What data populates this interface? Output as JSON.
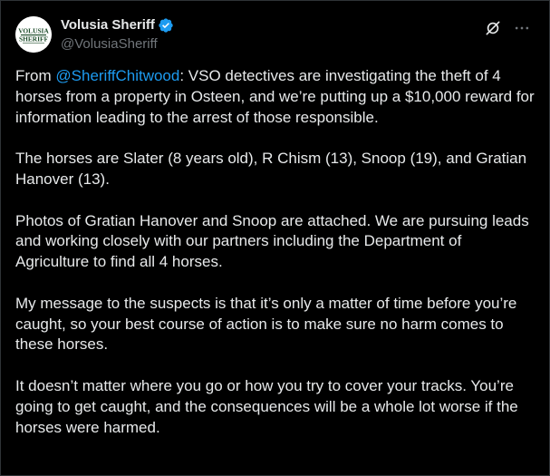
{
  "post": {
    "author": {
      "display_name": "Volusia Sheriff",
      "handle": "@VolusiaSheriff",
      "verified": true,
      "avatar_lines": [
        "VOLUSIA",
        "SHERIFF"
      ]
    },
    "actions": {
      "grok_icon": "grok-icon",
      "more_icon": "more-icon"
    },
    "text": {
      "p1_prefix": "From ",
      "p1_mention": "@SheriffChitwood",
      "p1_rest": ": VSO detectives are investigating the theft of 4 horses from a property in Osteen, and we’re putting up a $10,000 reward for information leading to the arrest of those responsible.",
      "p2": "The horses are Slater (8 years old), R Chism (13), Snoop (19), and Gratian Hanover (13).",
      "p3": "Photos of Gratian Hanover and Snoop are attached. We are pursuing leads and working closely with our partners including the Department of Agriculture to find all 4 horses.",
      "p4": "My message to the suspects is that it’s only a matter of time before you’re caught, so your best course of action is to make sure no harm comes to these horses.",
      "p5": "It doesn’t matter where you go or how you try to cover your tracks. You’re going to get caught, and the consequences will be a whole lot worse if the horses were harmed."
    }
  },
  "colors": {
    "background": "#000000",
    "text": "#e7e9ea",
    "secondary_text": "#71767b",
    "link": "#1d9bf0",
    "verified_badge": "#1d9bf0",
    "avatar_green": "#1f4e2c"
  }
}
